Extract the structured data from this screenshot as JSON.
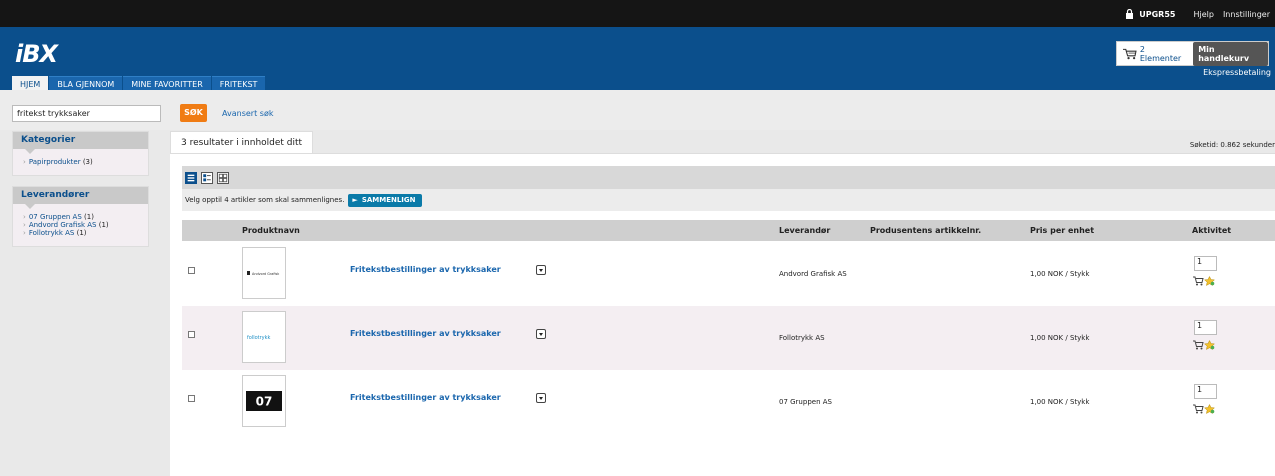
{
  "topbar": {
    "user": "UPGR55",
    "help": "Hjelp",
    "settings": "Innstillinger"
  },
  "header": {
    "logo": "iBX",
    "tabs": [
      "HJEM",
      "BLA GJENNOM",
      "MINE FAVORITTER",
      "FRITEKST"
    ],
    "cart_count": "2 Elementer",
    "cart_button": "Min handlekurv",
    "express": "Ekspressbetaling"
  },
  "search": {
    "value": "fritekst trykksaker",
    "button": "SØK",
    "advanced": "Avansert søk"
  },
  "sidebar": {
    "categories_title": "Kategorier",
    "categories": [
      {
        "label": "Papirprodukter",
        "count": "(3)"
      }
    ],
    "suppliers_title": "Leverandører",
    "suppliers": [
      {
        "label": "07 Gruppen AS",
        "count": "(1)"
      },
      {
        "label": "Andvord Grafisk AS",
        "count": "(1)"
      },
      {
        "label": "Follotrykk AS",
        "count": "(1)"
      }
    ]
  },
  "results": {
    "tab_label": "3 resultater i innholdet ditt",
    "search_time": "Søketid: 0.862 sekunder",
    "compare_text": "Velg opptil 4 artikler som skal sammenlignes.",
    "compare_button": "SAMMENLIGN",
    "columns": [
      "Produktnavn",
      "Leverandør",
      "Produsentens artikkelnr.",
      "Pris per enhet",
      "Aktivitet"
    ],
    "rows": [
      {
        "name": "Fritekstbestillinger av trykksaker",
        "supplier": "Andvord Grafisk AS",
        "price": "1,00 NOK /  Stykk",
        "qty": "1",
        "logo": "andvord",
        "logo_text": "Andvord Grafisk"
      },
      {
        "name": "Fritekstbestillinger av trykksaker",
        "supplier": "Follotrykk AS",
        "price": "1,00 NOK /  Stykk",
        "qty": "1",
        "logo": "follo",
        "logo_text": "follotrykk"
      },
      {
        "name": "Fritekstbestillinger av trykksaker",
        "supplier": "07 Gruppen AS",
        "price": "1,00 NOK /  Stykk",
        "qty": "1",
        "logo": "07",
        "logo_text": "07"
      }
    ]
  }
}
